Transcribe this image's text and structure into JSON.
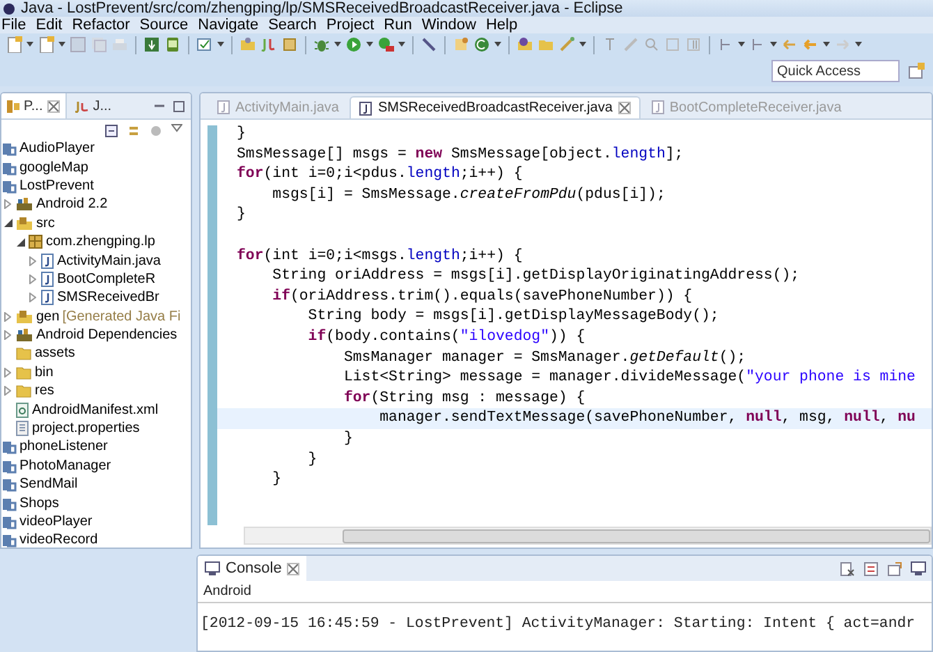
{
  "window": {
    "title": "Java - LostPrevent/src/com/zhengping/lp/SMSReceivedBroadcastReceiver.java - Eclipse"
  },
  "menu": [
    "File",
    "Edit",
    "Refactor",
    "Source",
    "Navigate",
    "Search",
    "Project",
    "Run",
    "Window",
    "Help"
  ],
  "quick_access": {
    "placeholder": "Quick Access"
  },
  "explorer": {
    "tabs": [
      {
        "label": "P...",
        "selected": true
      },
      {
        "label": "J...",
        "selected": false
      }
    ],
    "tree": [
      {
        "label": "AudioPlayer",
        "kind": "project"
      },
      {
        "label": "googleMap",
        "kind": "project"
      },
      {
        "label": "LostPrevent",
        "kind": "project"
      },
      {
        "label": "Android 2.2",
        "kind": "library",
        "expanded": false
      },
      {
        "label": "src",
        "kind": "source",
        "expanded": true,
        "children": [
          {
            "label": "com.zhengping.lp",
            "kind": "package",
            "expanded": true,
            "children": [
              {
                "label": "ActivityMain.java",
                "kind": "java",
                "expanded": false
              },
              {
                "label": "BootCompleteR",
                "kind": "java",
                "expanded": false
              },
              {
                "label": "SMSReceivedBr",
                "kind": "java",
                "expanded": false
              }
            ]
          }
        ]
      },
      {
        "label": "gen",
        "decoration": "[Generated Java Fi",
        "kind": "source",
        "expanded": false
      },
      {
        "label": "Android Dependencies",
        "kind": "library",
        "expanded": false
      },
      {
        "label": "assets",
        "kind": "folder"
      },
      {
        "label": "bin",
        "kind": "folder",
        "expanded": false
      },
      {
        "label": "res",
        "kind": "folder",
        "expanded": false
      },
      {
        "label": "AndroidManifest.xml",
        "kind": "xml"
      },
      {
        "label": "project.properties",
        "kind": "file"
      },
      {
        "label": "phoneListener",
        "kind": "project"
      },
      {
        "label": "PhotoManager",
        "kind": "project"
      },
      {
        "label": "SendMail",
        "kind": "project"
      },
      {
        "label": "Shops",
        "kind": "project"
      },
      {
        "label": "videoPlayer",
        "kind": "project"
      },
      {
        "label": "videoRecord",
        "kind": "project"
      }
    ]
  },
  "editor": {
    "tabs": [
      {
        "label": "ActivityMain.java",
        "selected": false
      },
      {
        "label": "SMSReceivedBroadcastReceiver.java",
        "selected": true
      },
      {
        "label": "BootCompleteReceiver.java",
        "selected": false
      }
    ],
    "lines": [
      {
        "current": false,
        "segments": [
          {
            "text": "}",
            "kind": "plain"
          }
        ]
      },
      {
        "current": false,
        "segments": [
          {
            "text": "SmsMessage[] msgs = ",
            "kind": "plain"
          },
          {
            "text": "new",
            "kind": "keyword"
          },
          {
            "text": " SmsMessage[object.",
            "kind": "plain"
          },
          {
            "text": "length",
            "kind": "field"
          },
          {
            "text": "];",
            "kind": "plain"
          }
        ]
      },
      {
        "current": false,
        "segments": [
          {
            "text": "for",
            "kind": "keyword"
          },
          {
            "text": "(int i=0;i<pdus.",
            "kind": "plain"
          },
          {
            "text": "length",
            "kind": "field"
          },
          {
            "text": ";i++) {",
            "kind": "plain"
          }
        ]
      },
      {
        "current": false,
        "segments": [
          {
            "text": "    msgs[i] = SmsMessage.",
            "kind": "plain"
          },
          {
            "text": "createFromPdu",
            "kind": "static"
          },
          {
            "text": "(pdus[i]);",
            "kind": "plain"
          }
        ]
      },
      {
        "current": false,
        "segments": [
          {
            "text": "}",
            "kind": "plain"
          }
        ]
      },
      {
        "current": false
      },
      {
        "current": false,
        "segments": [
          {
            "text": "for",
            "kind": "keyword"
          },
          {
            "text": "(int i=0;i<msgs.",
            "kind": "plain"
          },
          {
            "text": "length",
            "kind": "field"
          },
          {
            "text": ";i++) {",
            "kind": "plain"
          }
        ]
      },
      {
        "current": false,
        "segments": [
          {
            "text": "    String oriAddress = msgs[i].getDisplayOriginatingAddress();",
            "kind": "plain"
          }
        ]
      },
      {
        "current": false,
        "segments": [
          {
            "text": "    if",
            "kind": "keyword"
          },
          {
            "text": "(oriAddress.trim().equals(savePhoneNumber)) {",
            "kind": "plain"
          }
        ]
      },
      {
        "current": false,
        "segments": [
          {
            "text": "        String body = msgs[i].getDisplayMessageBody();",
            "kind": "plain"
          }
        ]
      },
      {
        "current": false,
        "segments": [
          {
            "text": "        if",
            "kind": "keyword"
          },
          {
            "text": "(body.contains(",
            "kind": "plain"
          },
          {
            "text": "\"ilovedog\"",
            "kind": "string"
          },
          {
            "text": ")) {",
            "kind": "plain"
          }
        ]
      },
      {
        "current": false,
        "segments": [
          {
            "text": "            SmsManager manager = SmsManager.",
            "kind": "plain"
          },
          {
            "text": "getDefault",
            "kind": "static"
          },
          {
            "text": "();",
            "kind": "plain"
          }
        ]
      },
      {
        "current": false,
        "segments": [
          {
            "text": "            List<String> message = manager.divideMessage(",
            "kind": "plain"
          },
          {
            "text": "\"your phone is mine",
            "kind": "string"
          }
        ]
      },
      {
        "current": false,
        "segments": [
          {
            "text": "            for",
            "kind": "keyword"
          },
          {
            "text": "(String msg : message) {",
            "kind": "plain"
          }
        ]
      },
      {
        "current": true,
        "segments": [
          {
            "text": "                manager.sendTextMessage(savePhoneNumber, ",
            "kind": "plain"
          },
          {
            "text": "null",
            "kind": "keyword"
          },
          {
            "text": ", msg, ",
            "kind": "plain"
          },
          {
            "text": "null",
            "kind": "keyword"
          },
          {
            "text": ", ",
            "kind": "plain"
          },
          {
            "text": "nu",
            "kind": "keyword"
          }
        ]
      },
      {
        "current": false,
        "segments": [
          {
            "text": "            }",
            "kind": "plain"
          }
        ]
      },
      {
        "current": false,
        "segments": [
          {
            "text": "        }",
            "kind": "plain"
          }
        ]
      },
      {
        "current": false,
        "segments": [
          {
            "text": "    }",
            "kind": "plain"
          }
        ]
      }
    ]
  },
  "console": {
    "tab": {
      "label": "Console",
      "selected": true
    },
    "subtitle": "Android",
    "lines": [
      "[2012-09-15 16:45:59 - LostPrevent] ActivityManager: Starting: Intent { act=andr"
    ]
  }
}
